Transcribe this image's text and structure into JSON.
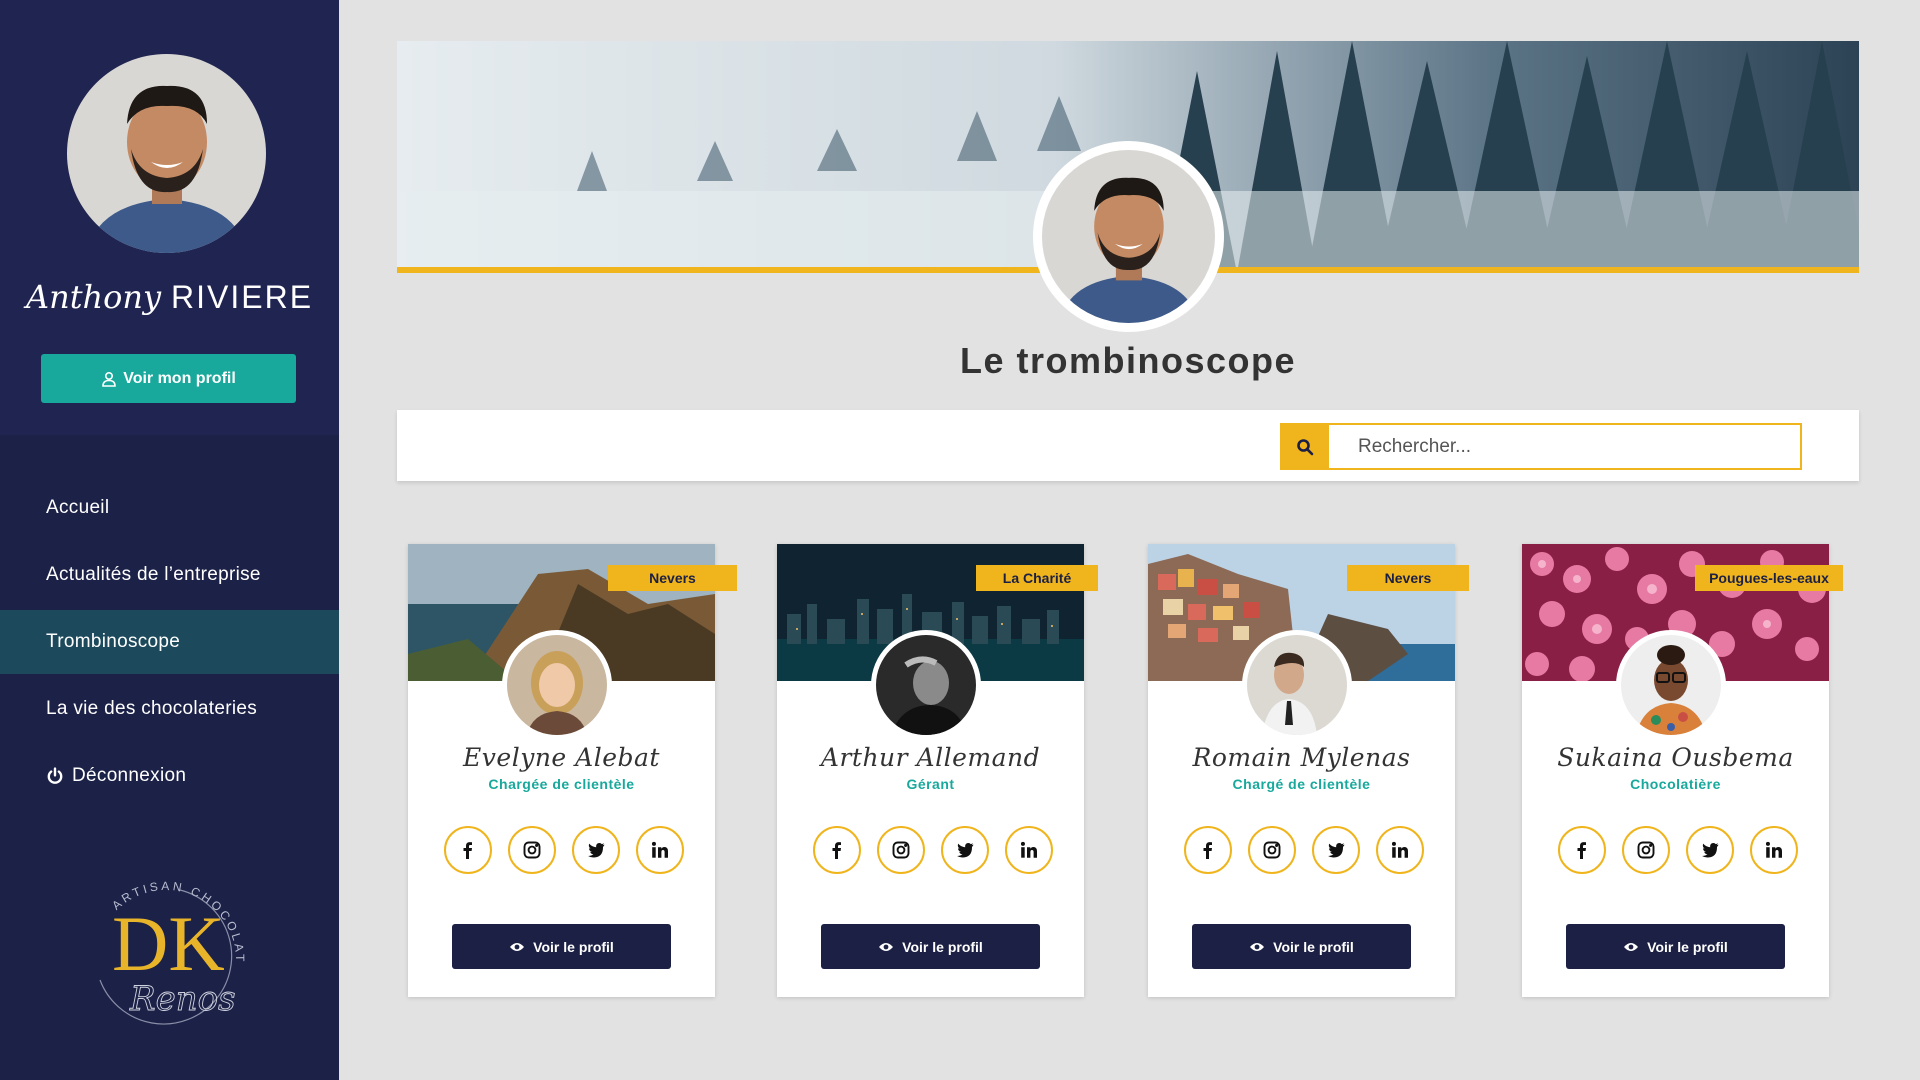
{
  "sidebar": {
    "user": {
      "first_name": "Anthony",
      "last_name": "RIVIERE"
    },
    "profile_button": "Voir mon profil",
    "nav": [
      {
        "label": "Accueil",
        "active": false
      },
      {
        "label": "Actualités de l’entreprise",
        "active": false
      },
      {
        "label": "Trombinoscope",
        "active": true
      },
      {
        "label": "La vie des chocolateries",
        "active": false
      },
      {
        "label": "Déconnexion",
        "active": false,
        "icon": "power-icon"
      }
    ],
    "logo": {
      "arc_text": "ARTISAN CHOCOLATIER",
      "monogram": "DK",
      "signature": "Renos"
    }
  },
  "main": {
    "title": "Le trombinoscope",
    "search": {
      "placeholder": "Rechercher..."
    }
  },
  "cards": [
    {
      "name": "Evelyne Alebat",
      "role": "Chargée de clientèle",
      "location": "Nevers",
      "button": "Voir le profil"
    },
    {
      "name": "Arthur Allemand",
      "role": "Gérant",
      "location": "La Charité",
      "button": "Voir le profil"
    },
    {
      "name": "Romain Mylenas",
      "role": "Chargé de clientèle",
      "location": "Nevers",
      "button": "Voir le profil"
    },
    {
      "name": "Sukaina Ousbema",
      "role": "Chocolatière",
      "location": "Pougues-les-eaux",
      "button": "Voir le profil"
    }
  ],
  "social_icons": [
    "facebook-icon",
    "instagram-icon",
    "twitter-icon",
    "linkedin-icon"
  ],
  "colors": {
    "sidebar": "#1c2147",
    "sidebar_active": "#1c4a5c",
    "accent_yellow": "#f0b51d",
    "accent_teal": "#18a99c",
    "button_dark": "#1c2044",
    "background": "#e2e2e2"
  }
}
